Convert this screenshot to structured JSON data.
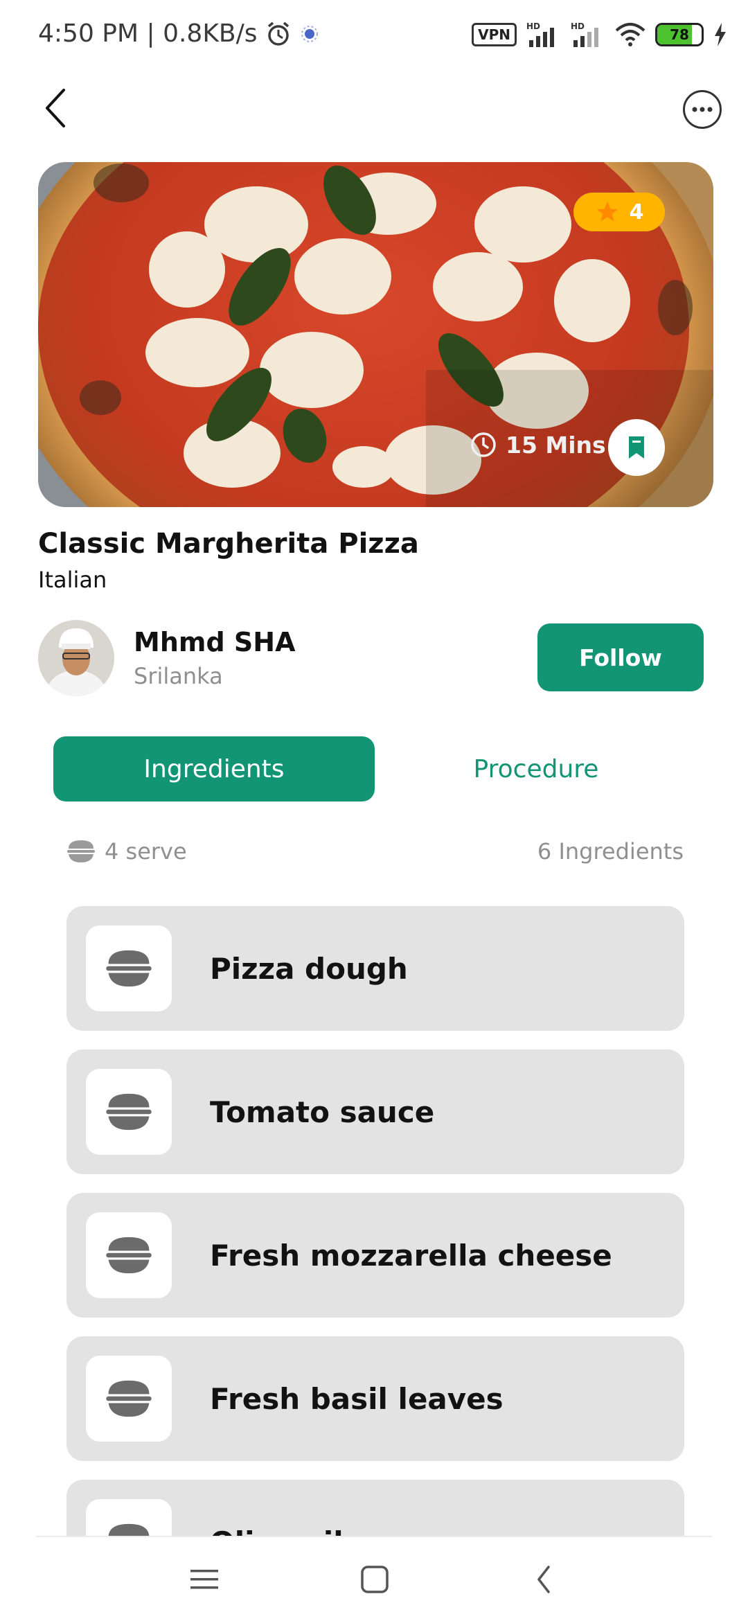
{
  "status_bar": {
    "time_speed": "4:50 PM | 0.8KB/s",
    "vpn_label": "VPN",
    "battery": "78",
    "battery_level": 0.78,
    "icons": [
      "alarm-icon",
      "app-icon",
      "signal-hd-icon",
      "signal-hd-icon",
      "wifi-icon",
      "battery-icon",
      "charging-icon"
    ]
  },
  "header": {
    "back_icon": "chevron-left-icon",
    "more_icon": "more-horizontal-icon"
  },
  "hero": {
    "rating": "4",
    "rating_icon": "star-icon",
    "time": "15 Mins",
    "time_icon": "clock-icon",
    "bookmark_icon": "bookmark-icon"
  },
  "recipe": {
    "title": "Classic Margherita Pizza",
    "cuisine": "Italian"
  },
  "author": {
    "name": "Mhmd SHA",
    "location": "Srilanka",
    "follow_label": "Follow"
  },
  "tabs": [
    {
      "label": "Ingredients",
      "active": true
    },
    {
      "label": "Procedure",
      "active": false
    }
  ],
  "meta": {
    "serve": "4 serve",
    "count": "6 Ingredients"
  },
  "ingredients": [
    {
      "name": "Pizza dough",
      "icon": "food-bowl-icon"
    },
    {
      "name": "Tomato sauce",
      "icon": "food-bowl-icon"
    },
    {
      "name": "Fresh mozzarella cheese",
      "icon": "food-bowl-icon"
    },
    {
      "name": "Fresh basil leaves",
      "icon": "food-bowl-icon"
    },
    {
      "name": "Olive oil",
      "icon": "food-bowl-icon"
    }
  ],
  "colors": {
    "primary": "#129575",
    "rating": "#ffb400",
    "card_bg": "#e3e3e3",
    "muted_text": "#8f8f8f"
  }
}
